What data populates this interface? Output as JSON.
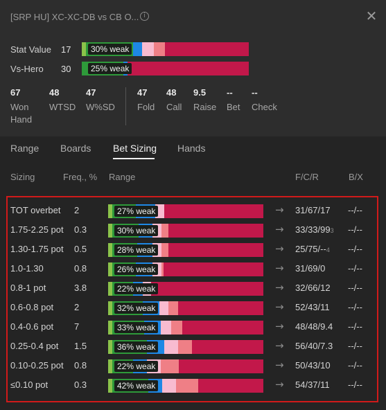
{
  "header": {
    "title": "[SRP HU] XC-XC-DB vs CB O...",
    "info_icon": "info-icon",
    "close_icon": "close-icon",
    "close_glyph": "✕"
  },
  "stats": [
    {
      "label": "Stat Value",
      "value": "17",
      "bar_label": "30% weak"
    },
    {
      "label": "Vs-Hero",
      "value": "30",
      "bar_label": "25% weak"
    }
  ],
  "metrics": [
    {
      "num": "67",
      "label": "Won Hand"
    },
    {
      "num": "48",
      "label": "WTSD"
    },
    {
      "num": "47",
      "label": "W%SD"
    },
    {
      "num": "47",
      "label": "Fold"
    },
    {
      "num": "48",
      "label": "Call"
    },
    {
      "num": "9.5",
      "label": "Raise"
    },
    {
      "num": "--",
      "label": "Bet"
    },
    {
      "num": "--",
      "label": "Check"
    }
  ],
  "tabs": [
    "Range",
    "Boards",
    "Bet Sizing",
    "Hands"
  ],
  "active_tab": "Bet Sizing",
  "columns": {
    "sizing": "Sizing",
    "freq": "Freq., %",
    "range": "Range",
    "fcr": "F/C/R",
    "bx": "B/X"
  },
  "rows": [
    {
      "sizing": "TOT overbet",
      "freq": "2",
      "weak": "27% weak",
      "fcr": "31/67/17",
      "fcr_sub": "",
      "bx": "--/--"
    },
    {
      "sizing": "1.75-2.25 pot",
      "freq": "0.3",
      "weak": "30% weak",
      "fcr": "33/33/99",
      "fcr_sub": "3",
      "bx": "--/--"
    },
    {
      "sizing": "1.30-1.75 pot",
      "freq": "0.5",
      "weak": "28% weak",
      "fcr": "25/75/--",
      "fcr_sub": "4",
      "bx": "--/--"
    },
    {
      "sizing": "1.0-1.30",
      "freq": "0.8",
      "weak": "26% weak",
      "fcr": "31/69/0",
      "fcr_sub": "",
      "bx": "--/--"
    },
    {
      "sizing": "0.8-1 pot",
      "freq": "3.8",
      "weak": "22% weak",
      "fcr": "32/66/12",
      "fcr_sub": "",
      "bx": "--/--"
    },
    {
      "sizing": "0.6-0.8 pot",
      "freq": "2",
      "weak": "32% weak",
      "fcr": "52/43/11",
      "fcr_sub": "",
      "bx": "--/--"
    },
    {
      "sizing": "0.4-0.6 pot",
      "freq": "7",
      "weak": "33% weak",
      "fcr": "48/48/9.4",
      "fcr_sub": "",
      "bx": "--/--"
    },
    {
      "sizing": "0.25-0.4 pot",
      "freq": "1.5",
      "weak": "36% weak",
      "fcr": "56/40/7.3",
      "fcr_sub": "",
      "bx": "--/--"
    },
    {
      "sizing": "0.10-0.25 pot",
      "freq": "0.8",
      "weak": "22% weak",
      "fcr": "50/43/10",
      "fcr_sub": "",
      "bx": "--/--"
    },
    {
      "sizing": "≤0.10 pot",
      "freq": "0.3",
      "weak": "42% weak",
      "fcr": "54/37/11",
      "fcr_sub": "",
      "bx": "--/--"
    }
  ],
  "arrow_glyph": "→",
  "colors": {
    "lightgreen": "#8bc34a",
    "green": "#2e9a3a",
    "blue": "#1e88e5",
    "pink": "#f8bbd0",
    "salmon": "#ef7f86",
    "crimson": "#c2184a",
    "highlight_border": "#d11a1a"
  }
}
